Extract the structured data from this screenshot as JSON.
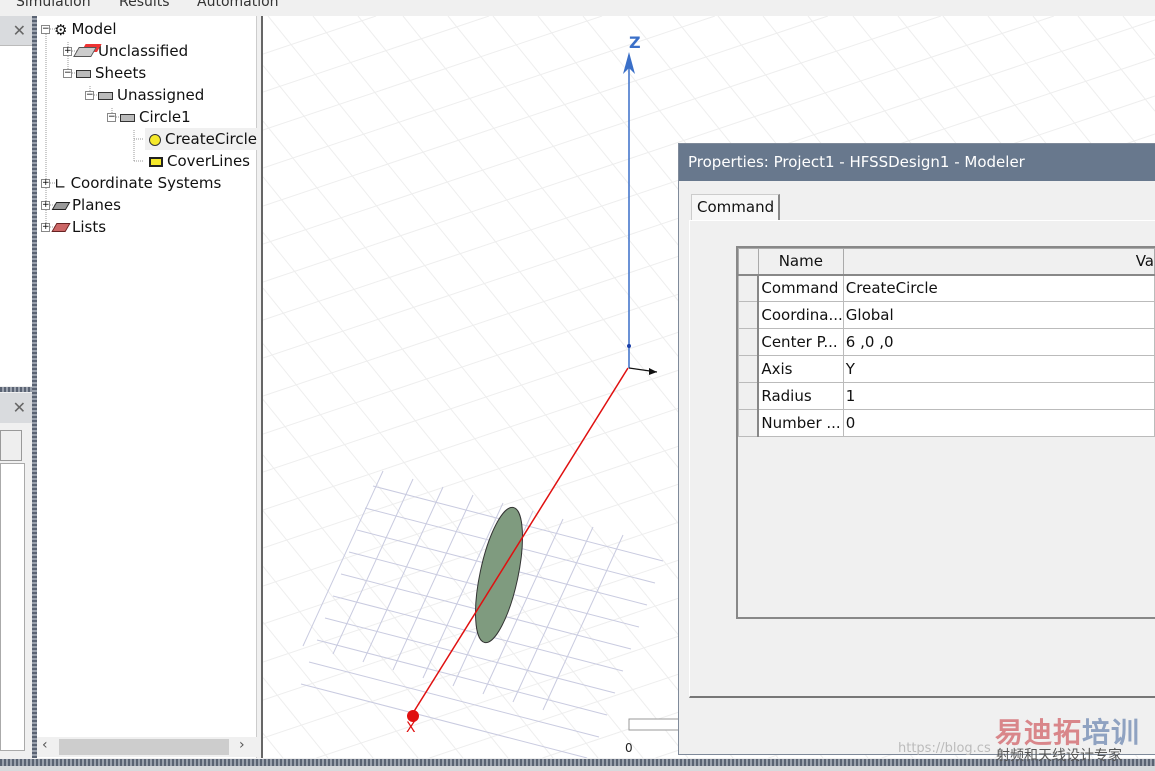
{
  "menu": [
    "Simulation",
    "Results",
    "Automation"
  ],
  "tree": [
    {
      "label": "Model",
      "icon": "model-icon",
      "expander": "minus"
    },
    {
      "label": "Unclassified",
      "icon": "unclassified-icon",
      "expander": "plus"
    },
    {
      "label": "Sheets",
      "icon": "sheet-icon",
      "expander": "minus"
    },
    {
      "label": "Unassigned",
      "icon": "sheet-icon",
      "expander": "minus"
    },
    {
      "label": "Circle1",
      "icon": "sheet-icon",
      "expander": "minus"
    },
    {
      "label": "CreateCircle",
      "icon": "circle-icon",
      "selected": true
    },
    {
      "label": "CoverLines",
      "icon": "cover-lines-icon"
    },
    {
      "label": "Coordinate Systems",
      "icon": "coordinate-systems-icon",
      "expander": "plus"
    },
    {
      "label": "Planes",
      "icon": "planes-icon",
      "expander": "plus"
    },
    {
      "label": "Lists",
      "icon": "lists-icon",
      "expander": "plus"
    }
  ],
  "viewport": {
    "z_label": "Z",
    "x_label": "X",
    "scale_zero": "0",
    "colors": {
      "z": "#3a6fc8",
      "x": "#e01010",
      "sheet": "#7f9b7f"
    }
  },
  "dialog": {
    "title": "Properties: Project1 - HFSSDesign1 - Modeler",
    "tab": "Command",
    "columns": [
      "Name",
      "Va"
    ],
    "rows": [
      {
        "name": "Command",
        "value": "CreateCircle"
      },
      {
        "name": "Coordina...",
        "value": "Global"
      },
      {
        "name": "Center P...",
        "value": "6 ,0 ,0"
      },
      {
        "name": "Axis",
        "value": "Y"
      },
      {
        "name": "Radius",
        "value": "1"
      },
      {
        "name": "Number ...",
        "value": "0"
      }
    ]
  },
  "watermark": {
    "brand": "易迪拓培训",
    "tagline": "射频和天线设计专家",
    "url": "https://blog.cs"
  }
}
